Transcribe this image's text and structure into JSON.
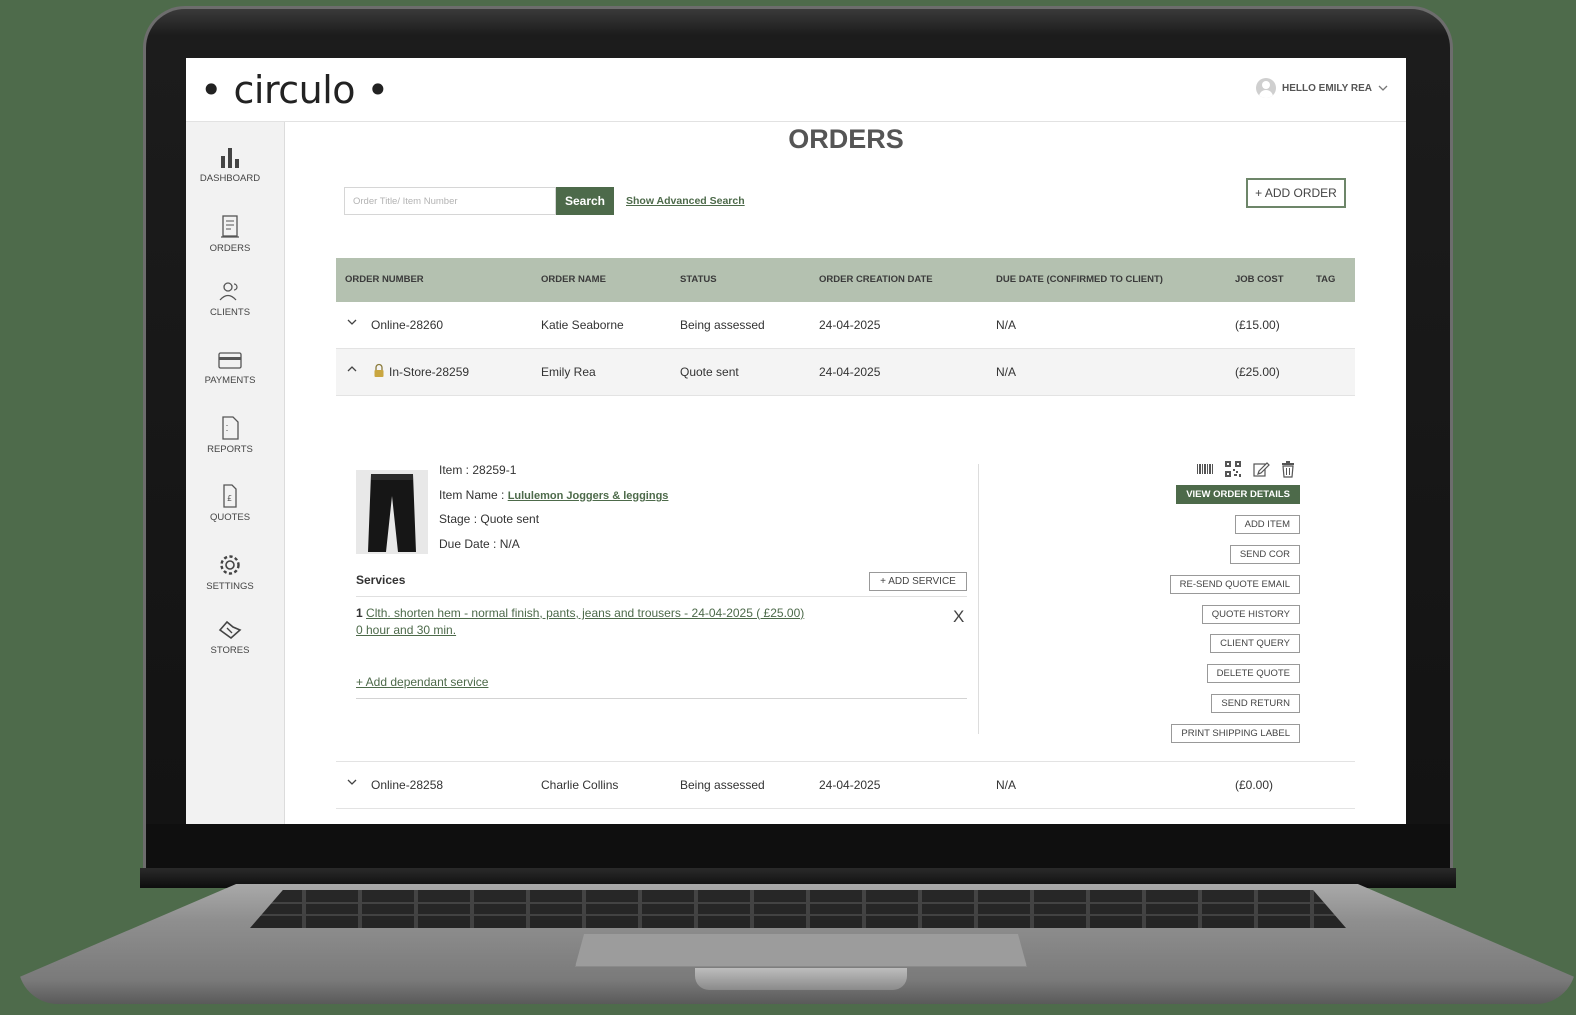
{
  "app": {
    "logo": "• circulo •"
  },
  "user": {
    "greeting": "HELLO EMILY REA"
  },
  "sidebar": {
    "items": [
      {
        "label": "DASHBOARD",
        "icon": "bar-chart-icon"
      },
      {
        "label": "ORDERS",
        "icon": "receipt-icon"
      },
      {
        "label": "CLIENTS",
        "icon": "users-icon"
      },
      {
        "label": "PAYMENTS",
        "icon": "credit-card-icon"
      },
      {
        "label": "REPORTS",
        "icon": "document-icon"
      },
      {
        "label": "QUOTES",
        "icon": "pound-document-icon"
      },
      {
        "label": "SETTINGS",
        "icon": "gear-icon"
      },
      {
        "label": "STORES",
        "icon": "handshake-icon"
      }
    ]
  },
  "page": {
    "title": "ORDERS",
    "search_placeholder": "Order Title/ Item Number",
    "search_button": "Search",
    "advanced_search": "Show Advanced Search",
    "add_order": "+ ADD ORDER"
  },
  "table": {
    "columns": [
      "ORDER NUMBER",
      "ORDER NAME",
      "STATUS",
      "ORDER CREATION DATE",
      "DUE DATE (CONFIRMED TO CLIENT)",
      "JOB COST",
      "TAG"
    ],
    "rows": [
      {
        "number": "Online-28260",
        "name": "Katie Seaborne",
        "status": "Being assessed",
        "created": "24-04-2025",
        "due": "N/A",
        "cost": "(£15.00)",
        "expanded": false
      },
      {
        "number": "In-Store-28259",
        "name": "Emily Rea",
        "status": "Quote sent",
        "created": "24-04-2025",
        "due": "N/A",
        "cost": "(£25.00)",
        "expanded": true
      },
      {
        "number": "Online-28258",
        "name": "Charlie Collins",
        "status": "Being assessed",
        "created": "24-04-2025",
        "due": "N/A",
        "cost": "(£0.00)",
        "expanded": false
      }
    ]
  },
  "detail": {
    "item": "Item : 28259-1",
    "item_name_label": "Item Name : ",
    "item_name": "Lululemon Joggers & leggings",
    "stage": "Stage : Quote sent",
    "due_date": "Due Date : N/A",
    "services_label": "Services",
    "add_service": "+ ADD SERVICE",
    "service_index": "1",
    "service_text": "Clth. shorten hem - normal finish, pants, jeans and trousers - 24-04-2025 ( £25.00)",
    "service_duration": "0 hour and 30 min.",
    "remove_service": "X",
    "add_dependant": "+ Add dependant service",
    "actions": [
      "VIEW ORDER DETAILS",
      "ADD ITEM",
      "SEND COR",
      "RE-SEND QUOTE EMAIL",
      "QUOTE HISTORY",
      "CLIENT QUERY",
      "DELETE QUOTE",
      "SEND RETURN",
      "PRINT SHIPPING LABEL"
    ]
  },
  "colors": {
    "accent": "#4d6a4a",
    "table_header": "#b4c1b0",
    "background": "#4e6b4b"
  }
}
